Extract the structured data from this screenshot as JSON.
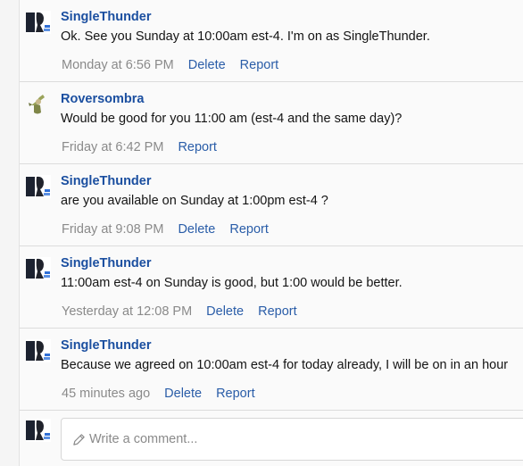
{
  "comments": [
    {
      "author": "SingleThunder",
      "avatar_icon": "single-thunder-avatar",
      "text": "Ok. See you Sunday at 10:00am est-4. I'm on as SingleThunder.",
      "time": "Monday at 6:56 PM",
      "delete_label": "Delete",
      "report_label": "Report"
    },
    {
      "author": "Roversombra",
      "avatar_icon": "roversombra-avatar",
      "text": "Would be good for you 11:00 am (est-4 and the same day)?",
      "time": "Friday at 6:42 PM",
      "report_label": "Report"
    },
    {
      "author": "SingleThunder",
      "avatar_icon": "single-thunder-avatar",
      "text": "are you available on Sunday at 1:00pm est-4 ?",
      "time": "Friday at 9:08 PM",
      "delete_label": "Delete",
      "report_label": "Report"
    },
    {
      "author": "SingleThunder",
      "avatar_icon": "single-thunder-avatar",
      "text": "11:00am est-4 on Sunday is good, but 1:00 would be better.",
      "time": "Yesterday at 12:08 PM",
      "delete_label": "Delete",
      "report_label": "Report"
    },
    {
      "author": "SingleThunder",
      "avatar_icon": "single-thunder-avatar",
      "text": "Because we agreed on 10:00am est-4 for today already, I will be on in an hour",
      "time": "45 minutes ago",
      "delete_label": "Delete",
      "report_label": "Report"
    }
  ],
  "composer": {
    "placeholder": "Write a comment...",
    "icon": "pencil-icon"
  },
  "colors": {
    "author": "#1b4fa0",
    "action_link": "#2a5da8",
    "timestamp": "#8a8a8a",
    "body_text": "#141414",
    "panel_background": "#fafafa"
  }
}
